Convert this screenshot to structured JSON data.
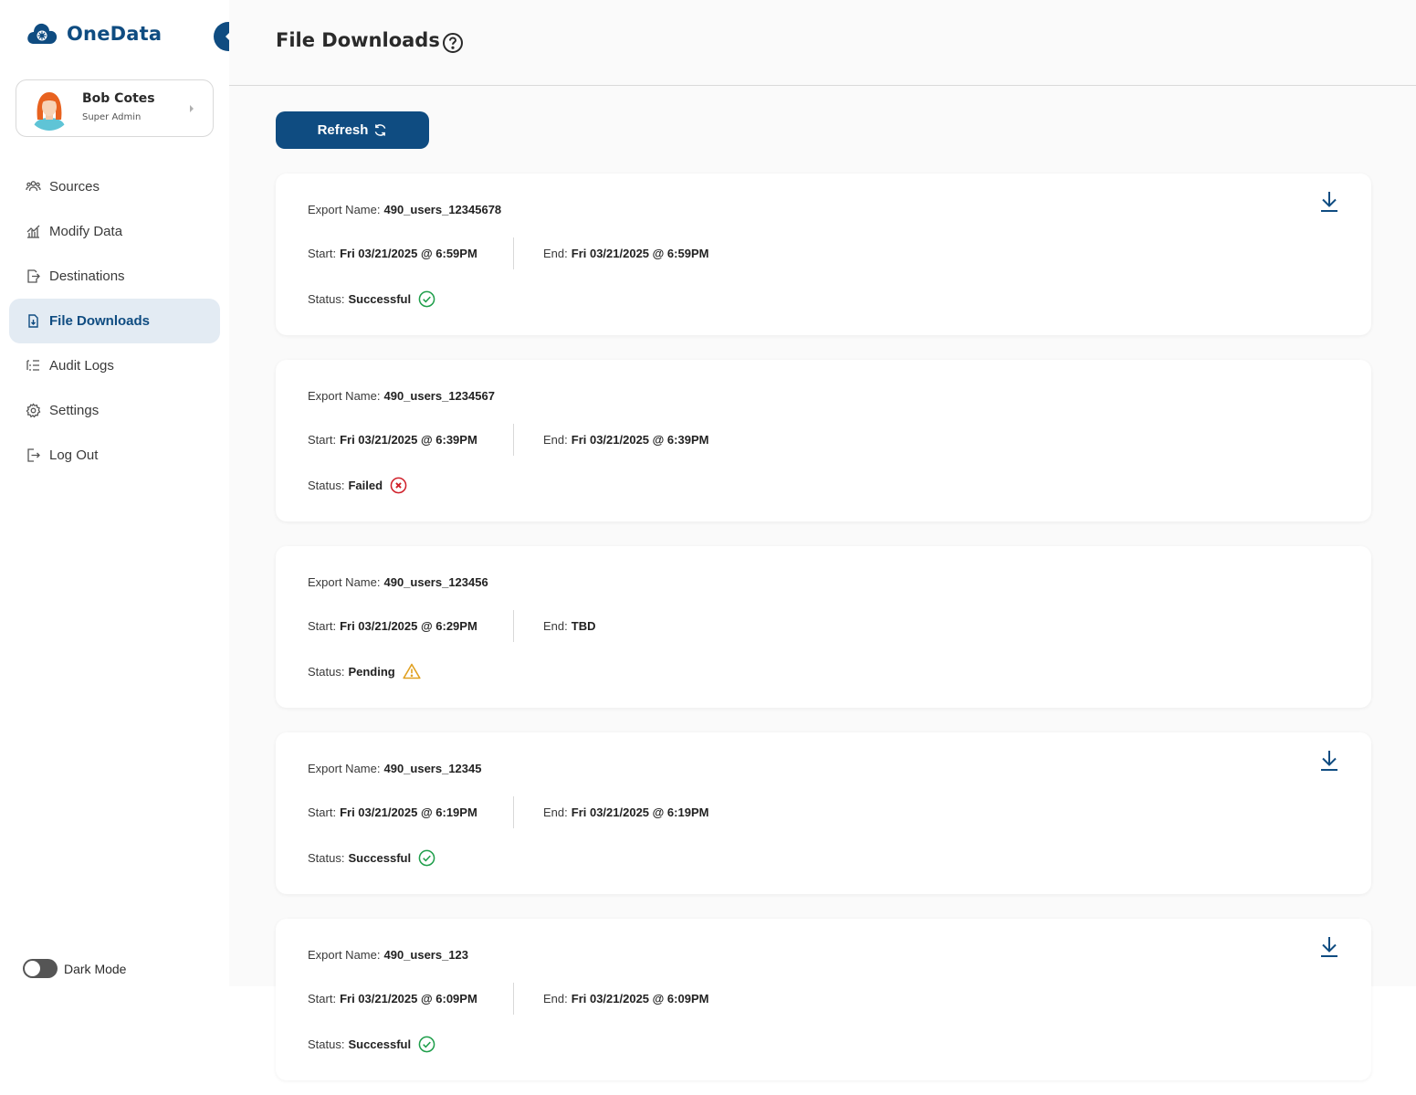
{
  "app": {
    "name": "OneData",
    "brand_color": "#0f4c81"
  },
  "user": {
    "name": "Bob Cotes",
    "role": "Super Admin"
  },
  "nav": {
    "items": [
      {
        "label": "Sources",
        "icon": "users-icon"
      },
      {
        "label": "Modify Data",
        "icon": "chart-icon"
      },
      {
        "label": "Destinations",
        "icon": "export-icon"
      },
      {
        "label": "File Downloads",
        "icon": "file-download-icon",
        "active": true
      },
      {
        "label": "Audit Logs",
        "icon": "list-icon"
      },
      {
        "label": "Settings",
        "icon": "gear-icon"
      },
      {
        "label": "Log Out",
        "icon": "logout-icon"
      }
    ]
  },
  "dark_mode": {
    "label": "Dark Mode",
    "enabled": false
  },
  "page": {
    "title": "File Downloads"
  },
  "toolbar": {
    "refresh_label": "Refresh"
  },
  "labels": {
    "export_name": "Export Name:",
    "start": "Start:",
    "end": "End:",
    "status": "Status:"
  },
  "downloads": [
    {
      "export_name": "490_users_12345678",
      "start": "Fri 03/21/2025 @ 6:59PM",
      "end": "Fri 03/21/2025 @ 6:59PM",
      "status": "Successful",
      "status_color": "#1e9e4a",
      "downloadable": true
    },
    {
      "export_name": "490_users_1234567",
      "start": "Fri 03/21/2025 @ 6:39PM",
      "end": "Fri 03/21/2025 @ 6:39PM",
      "status": "Failed",
      "status_color": "#d0202a",
      "downloadable": false
    },
    {
      "export_name": "490_users_123456",
      "start": "Fri 03/21/2025 @ 6:29PM",
      "end": "TBD",
      "status": "Pending",
      "status_color": "#e0a020",
      "downloadable": false
    },
    {
      "export_name": "490_users_12345",
      "start": "Fri 03/21/2025 @ 6:19PM",
      "end": "Fri 03/21/2025 @ 6:19PM",
      "status": "Successful",
      "status_color": "#1e9e4a",
      "downloadable": true
    },
    {
      "export_name": "490_users_123",
      "start": "Fri 03/21/2025 @ 6:09PM",
      "end": "Fri 03/21/2025 @ 6:09PM",
      "status": "Successful",
      "status_color": "#1e9e4a",
      "downloadable": true
    }
  ]
}
